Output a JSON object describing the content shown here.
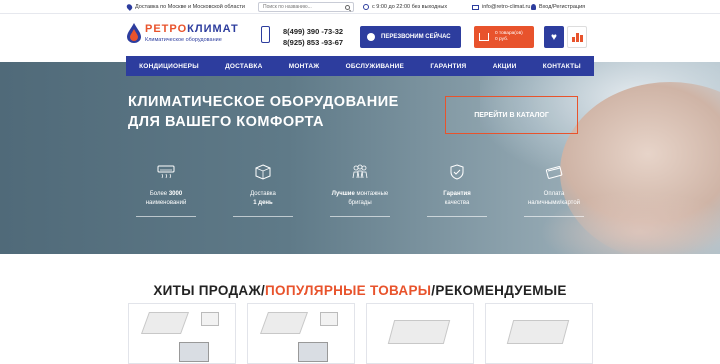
{
  "topbar": {
    "delivery": "Доставка по Москве и Московской области",
    "search_placeholder": "Поиск по названию...",
    "hours": "с 9:00 до 22:00 без выходных",
    "email": "info@retro-climat.ru",
    "login": "Вход/Регистрация"
  },
  "header": {
    "brand_part1": "РЕТРО",
    "brand_part2": "КЛИМАТ",
    "tagline": "Климатическое оборудование",
    "phone1": "8(499) 390 -73-32",
    "phone2": "8(925) 853 -93-67",
    "callback_label": "ПЕРЕЗВОНИМ СЕЙЧАС",
    "cart_line1": "0 товара(ов)",
    "cart_line2": "0 руб.",
    "colors": {
      "primary": "#2d3d9e",
      "accent": "#e8532c"
    }
  },
  "nav": {
    "items": [
      "КОНДИЦИОНЕРЫ",
      "ДОСТАВКА",
      "МОНТАЖ",
      "ОБСЛУЖИВАНИЕ",
      "ГАРАНТИЯ",
      "АКЦИИ",
      "КОНТАКТЫ"
    ]
  },
  "hero": {
    "title_line1": "КЛИМАТИЧЕСКОЕ ОБОРУДОВАНИЕ",
    "title_line2": "ДЛЯ ВАШЕГО КОМФОРТА",
    "catalog_button": "ПЕРЕЙТИ В КАТАЛОГ",
    "features": [
      {
        "icon": "air-conditioner-icon",
        "line1_pre": "Более ",
        "line1_bold": "3000",
        "line1_post": "",
        "line2_pre": "наименований",
        "line2_bold": ""
      },
      {
        "icon": "delivery-box-icon",
        "line1_pre": "Доставка",
        "line1_bold": "",
        "line1_post": "",
        "line2_pre": "",
        "line2_bold": "1 день"
      },
      {
        "icon": "installers-icon",
        "line1_pre": "",
        "line1_bold": "Лучшие",
        "line1_post": " монтажные",
        "line2_pre": "бригады",
        "line2_bold": ""
      },
      {
        "icon": "guarantee-shield-icon",
        "line1_pre": "",
        "line1_bold": "Гарантия",
        "line1_post": "",
        "line2_pre": "качества",
        "line2_bold": ""
      },
      {
        "icon": "payment-card-icon",
        "line1_pre": "Оплата",
        "line1_bold": "",
        "line1_post": "",
        "line2_pre": "наличными/картой",
        "line2_bold": ""
      }
    ]
  },
  "products": {
    "title_part1": "ХИТЫ ПРОДАЖ/",
    "title_part2": "ПОПУЛЯРНЫЕ ТОВАРЫ",
    "title_part3": "/РЕКОМЕНДУЕМЫЕ"
  }
}
